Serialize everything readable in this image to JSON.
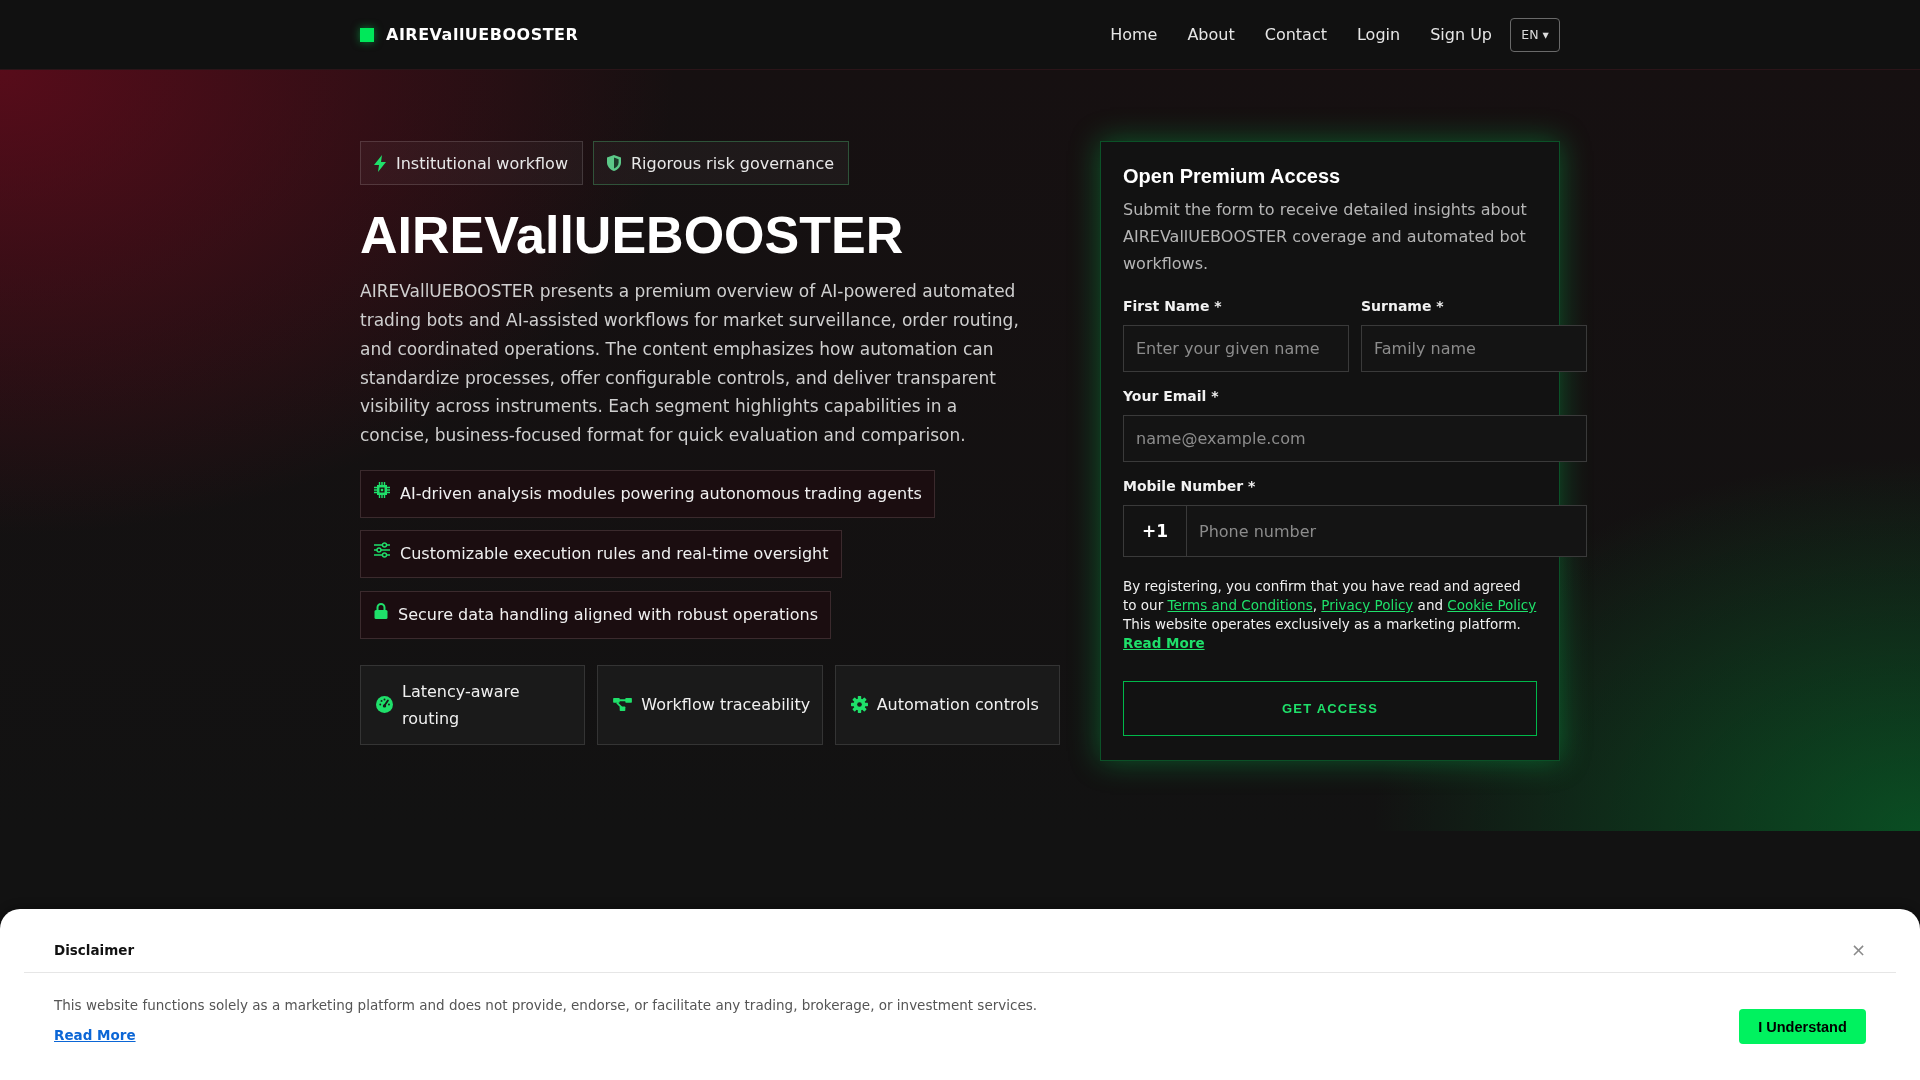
{
  "header": {
    "brand": "AIREVallUEBOOSTER",
    "nav": [
      "Home",
      "About",
      "Contact",
      "Login",
      "Sign Up"
    ],
    "language_button": "EN ▾"
  },
  "hero": {
    "badges": [
      {
        "label": "Institutional workflow",
        "kind": "neutral"
      },
      {
        "label": "Rigorous risk governance",
        "kind": "accent"
      }
    ],
    "title": "AIREVallUEBOOSTER",
    "intro": "AIREVallUEBOOSTER presents a premium overview of AI-powered automated trading bots and AI-assisted workflows for market surveillance, order routing, and coordinated operations. The content emphasizes how automation can standardize processes, offer configurable controls, and deliver transparent visibility across instruments. Each segment highlights capabilities in a concise, business-focused format for quick evaluation and comparison.",
    "features": [
      "AI-driven analysis modules powering autonomous trading agents",
      "Customizable execution rules and real-time oversight",
      "Secure data handling aligned with robust operations"
    ],
    "cards": [
      "Latency-aware routing",
      "Workflow traceability",
      "Automation controls"
    ]
  },
  "form": {
    "title": "Open Premium Access",
    "description": "Submit the form to receive detailed insights about AIREVallUEBOOSTER coverage and automated bot workflows.",
    "fields": [
      {
        "kind": "half",
        "label": "First Name *",
        "placeholder": "Enter your given name"
      },
      {
        "kind": "half",
        "label": "Surname *",
        "placeholder": "Family name"
      },
      {
        "kind": "full",
        "label": "Your Email *",
        "placeholder": "name@example.com"
      },
      {
        "kind": "phone",
        "label": "Mobile Number *",
        "prefix": "+1",
        "placeholder": "Phone number"
      }
    ],
    "consent": [
      {
        "kind": "text",
        "text": "By registering, you confirm that you have read and agreed to our "
      },
      {
        "kind": "link",
        "text": "Terms and Conditions"
      },
      {
        "kind": "text",
        "text": ", "
      },
      {
        "kind": "link",
        "text": "Privacy Policy"
      },
      {
        "kind": "text",
        "text": " and "
      },
      {
        "kind": "link",
        "text": "Cookie Policy"
      },
      {
        "kind": "text",
        "text": " This website operates exclusively as a marketing platform. "
      },
      {
        "kind": "strong_link",
        "text": "Read More"
      }
    ],
    "submit": "GET ACCESS"
  },
  "disclaimer": {
    "title": "Disclaimer",
    "close": "×",
    "text": "This website functions solely as a marketing platform and does not provide, endorse, or facilitate any trading, brokerage, or investment services.",
    "link": "Read More",
    "button": "I Understand"
  }
}
